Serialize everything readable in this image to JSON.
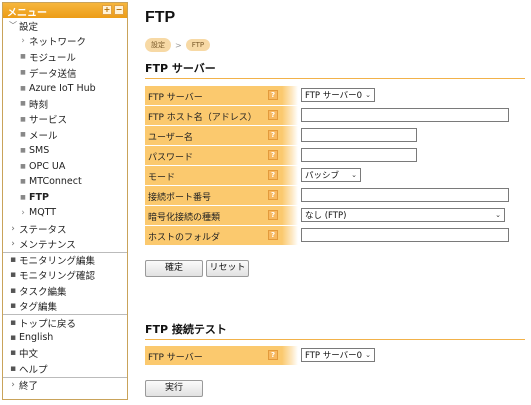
{
  "sidebar": {
    "title": "メニュー",
    "expand_glyph": "+",
    "collapse_glyph": "−",
    "items": [
      {
        "label": "設定",
        "level": 0,
        "marker": "chevron-down"
      },
      {
        "label": "ネットワーク",
        "level": 1,
        "marker": "chevron-right"
      },
      {
        "label": "モジュール",
        "level": 1,
        "marker": "square"
      },
      {
        "label": "データ送信",
        "level": 1,
        "marker": "square"
      },
      {
        "label": "Azure IoT Hub",
        "level": 1,
        "marker": "square"
      },
      {
        "label": "時刻",
        "level": 1,
        "marker": "square"
      },
      {
        "label": "サービス",
        "level": 1,
        "marker": "square"
      },
      {
        "label": "メール",
        "level": 1,
        "marker": "square"
      },
      {
        "label": "SMS",
        "level": 1,
        "marker": "square"
      },
      {
        "label": "OPC UA",
        "level": 1,
        "marker": "square"
      },
      {
        "label": "MTConnect",
        "level": 1,
        "marker": "square"
      },
      {
        "label": "FTP",
        "level": 1,
        "marker": "square",
        "active": true
      },
      {
        "label": "MQTT",
        "level": 1,
        "marker": "chevron-right"
      },
      {
        "label": "ステータス",
        "level": 0,
        "marker": "chevron-right"
      },
      {
        "label": "メンテナンス",
        "level": 0,
        "marker": "chevron-right"
      },
      {
        "label": "モニタリング編集",
        "level": 0,
        "marker": "square",
        "separator": true
      },
      {
        "label": "モニタリング確認",
        "level": 0,
        "marker": "square"
      },
      {
        "label": "タスク編集",
        "level": 0,
        "marker": "square"
      },
      {
        "label": "タグ編集",
        "level": 0,
        "marker": "square"
      },
      {
        "label": "トップに戻る",
        "level": 0,
        "marker": "square",
        "separator": true
      },
      {
        "label": "English",
        "level": 0,
        "marker": "square"
      },
      {
        "label": "中文",
        "level": 0,
        "marker": "square"
      },
      {
        "label": "ヘルプ",
        "level": 0,
        "marker": "square"
      },
      {
        "label": "終了",
        "level": 0,
        "marker": "chevron-right",
        "separator": true
      }
    ]
  },
  "main": {
    "title": "FTP",
    "breadcrumb": [
      "設定",
      "FTP"
    ],
    "breadcrumb_sep": ">",
    "server_section": {
      "title": "FTP サーバー",
      "fields": [
        {
          "label": "FTP サーバー",
          "type": "select",
          "value": "FTP サーバー0"
        },
        {
          "label": "FTP ホスト名（アドレス）",
          "type": "text",
          "value": ""
        },
        {
          "label": "ユーザー名",
          "type": "text",
          "value": ""
        },
        {
          "label": "パスワード",
          "type": "password",
          "value": ""
        },
        {
          "label": "モード",
          "type": "select",
          "value": "パッシブ"
        },
        {
          "label": "接続ポート番号",
          "type": "text",
          "value": ""
        },
        {
          "label": "暗号化接続の種類",
          "type": "select",
          "value": "なし (FTP)"
        },
        {
          "label": "ホストのフォルダ",
          "type": "text",
          "value": ""
        }
      ],
      "confirm_label": "確定",
      "reset_label": "リセット"
    },
    "test_section": {
      "title": "FTP 接続テスト",
      "field": {
        "label": "FTP サーバー",
        "type": "select",
        "value": "FTP サーバー0"
      },
      "run_label": "実行"
    },
    "help_glyph": "?"
  },
  "colors": {
    "accent": "#f0a020",
    "label_bg": "#fbc96e",
    "crumb_bg": "#f7d9a5"
  }
}
